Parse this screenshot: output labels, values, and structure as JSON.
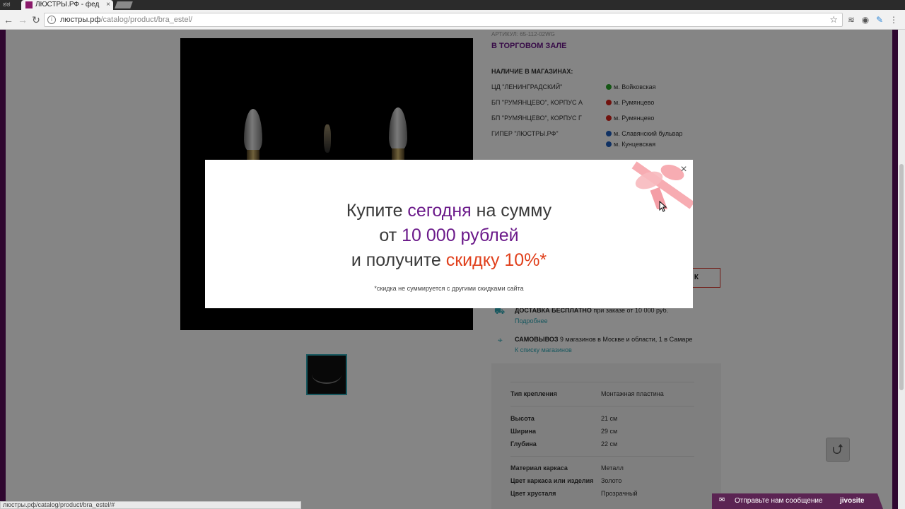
{
  "browser": {
    "tab_title": "ЛЮСТРЫ.РФ - фед",
    "tab_close": "×",
    "url_host": "люстры.рф",
    "url_path": "/catalog/product/bra_estel/",
    "status_url": "люстры.рф/catalog/product/bra_estel/#"
  },
  "product": {
    "article": "АРТИКУЛ: 65-112-02WG",
    "in_store": "В ТОРГОВОМ ЗАЛЕ",
    "availability_title": "НАЛИЧИЕ В МАГАЗИНАХ:",
    "stores": [
      {
        "name": "ЦД \"ЛЕНИНГРАДСКИЙ\"",
        "metro": "м. Войковская",
        "color": "#2aa52a"
      },
      {
        "name": "БП \"РУМЯНЦЕВО\", КОРПУС А",
        "metro": "м. Румянцево",
        "color": "#d9231b"
      },
      {
        "name": "БП \"РУМЯНЦЕВО\", КОРПУС Г",
        "metro": "м. Румянцево",
        "color": "#d9231b"
      },
      {
        "name": "ГИПЕР \"ЛЮСТРЫ.РФ\"",
        "metro": "м. Славянский бульвар",
        "metro2": "м. Кунцевская",
        "color": "#1f5fbf"
      }
    ],
    "buy_button_partial": "К",
    "delivery_title": "ДОСТАВКА БЕСПЛАТНО",
    "delivery_text": " при заказе от 10 000 руб.",
    "delivery_link": "Подробнее",
    "pickup_title": "САМОВЫВОЗ",
    "pickup_text": " 9 магазинов в Москве и области, 1 в Самаре",
    "pickup_link": "К списку магазинов"
  },
  "specs": [
    {
      "k": "Тип крепления",
      "v": "Монтажная пластина"
    },
    {
      "k": "Высота",
      "v": "21 см"
    },
    {
      "k": "Ширина",
      "v": "29 см"
    },
    {
      "k": "Глубина",
      "v": "22 см"
    },
    {
      "k": "Материал каркаса",
      "v": "Металл"
    },
    {
      "k": "Цвет каркаса или изделия",
      "v": "Золото"
    },
    {
      "k": "Цвет хрусталя",
      "v": "Прозрачный"
    }
  ],
  "modal": {
    "close": "×",
    "l1_a": "Купите ",
    "l1_b": "сегодня",
    "l1_c": " на сумму",
    "l2_a": "от ",
    "l2_b": "10 000 рублей",
    "l3_a": "и получите ",
    "l3_b": "скидку 10%*",
    "footnote": "*скидка не суммируется с другими скидками сайта"
  },
  "chat": {
    "text": "Отправьте нам сообщение",
    "brand": "jivosite"
  },
  "colors": {
    "brand_purple": "#6b1a8a",
    "accent_red": "#e0401c",
    "link_teal": "#2fa9b7"
  }
}
